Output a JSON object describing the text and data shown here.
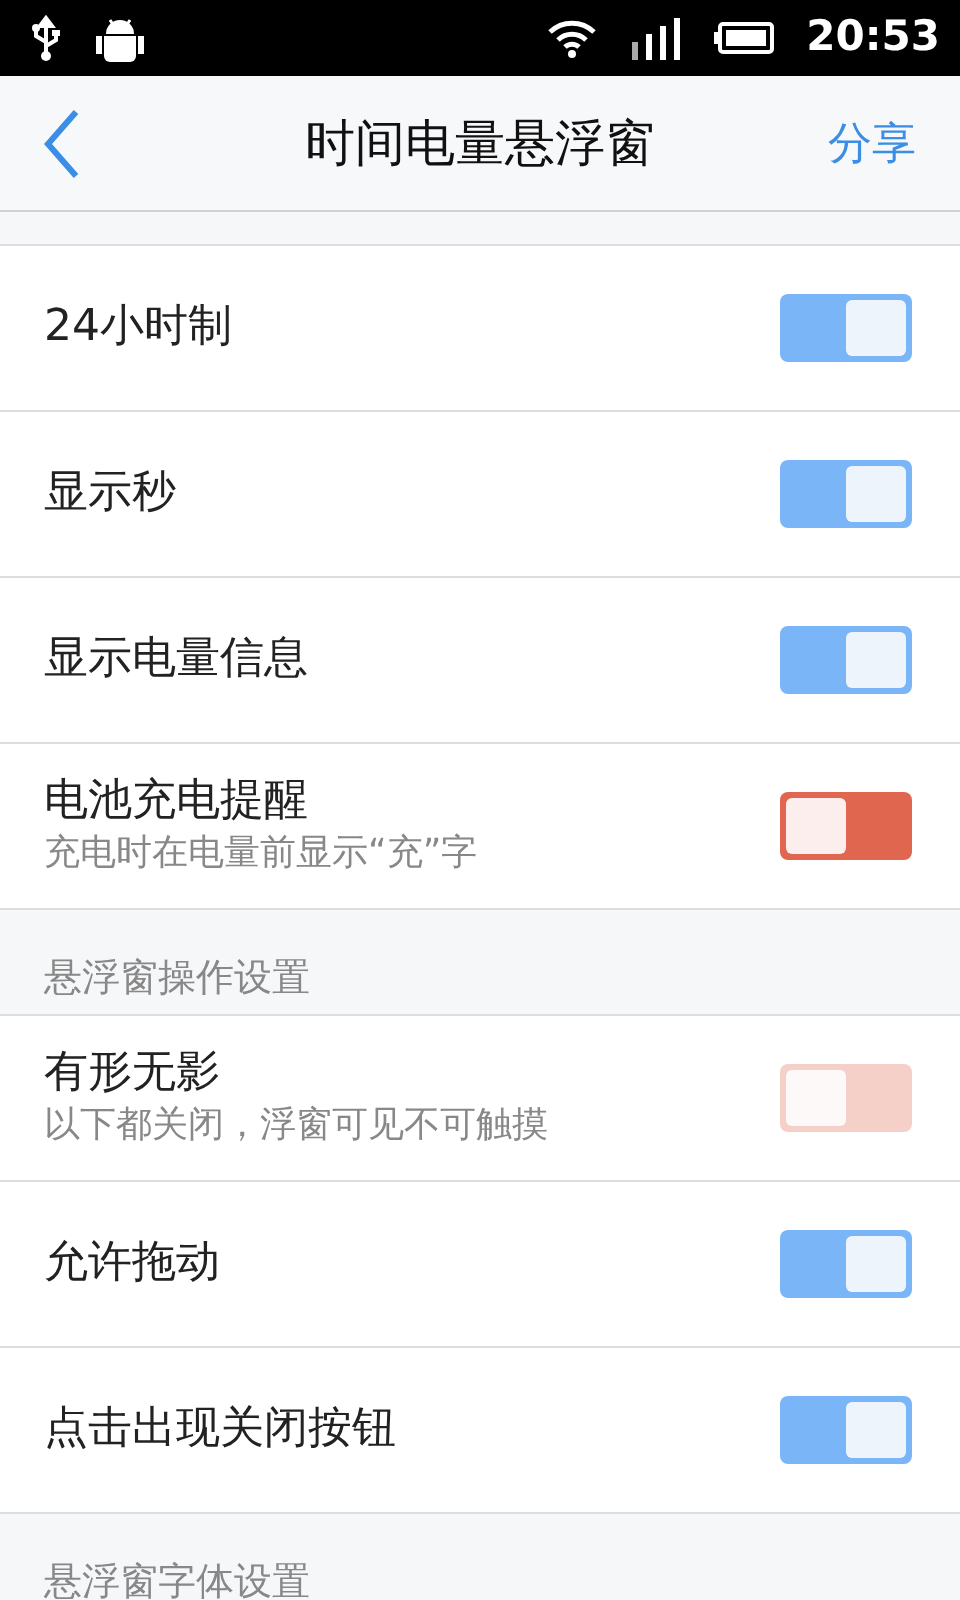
{
  "status_bar": {
    "time": "20:53"
  },
  "header": {
    "title": "时间电量悬浮窗",
    "action": "分享"
  },
  "sections": [
    {
      "rows": [
        {
          "label": "24小时制",
          "checked": true,
          "disabled": false
        },
        {
          "label": "显示秒",
          "checked": true,
          "disabled": false
        },
        {
          "label": "显示电量信息",
          "checked": true,
          "disabled": false
        },
        {
          "label": "电池充电提醒",
          "subtitle": "充电时在电量前显示“充”字",
          "checked": false,
          "disabled": false
        }
      ]
    },
    {
      "title": "悬浮窗操作设置",
      "rows": [
        {
          "label": "有形无影",
          "subtitle": "以下都关闭，浮窗可见不可触摸",
          "checked": false,
          "disabled": true
        },
        {
          "label": "允许拖动",
          "checked": true,
          "disabled": false
        },
        {
          "label": "点击出现关闭按钮",
          "checked": true,
          "disabled": false
        }
      ]
    },
    {
      "title": "悬浮窗字体设置"
    }
  ]
}
